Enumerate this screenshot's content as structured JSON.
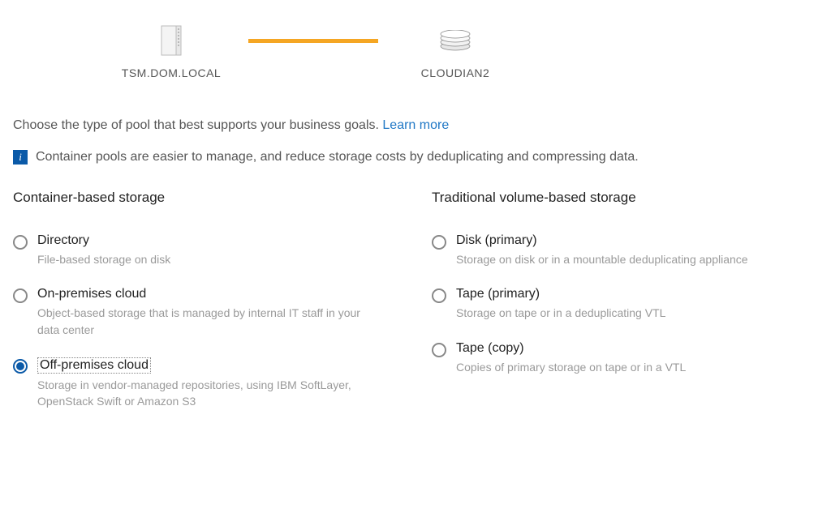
{
  "topology": {
    "source_label": "TSM.DOM.LOCAL",
    "target_label": "CLOUDIAN2"
  },
  "intro": {
    "text": "Choose the type of pool that best supports your business goals. ",
    "learn_more": "Learn more"
  },
  "info": {
    "text": "Container pools are easier to manage, and reduce storage costs by deduplicating and compressing data."
  },
  "columns": {
    "container": {
      "header": "Container-based storage",
      "options": [
        {
          "title": "Directory",
          "desc": "File-based storage on disk",
          "selected": false,
          "focused": false
        },
        {
          "title": "On-premises cloud",
          "desc": "Object-based storage that is managed by internal IT staff in your data center",
          "selected": false,
          "focused": false
        },
        {
          "title": "Off-premises cloud",
          "desc": "Storage in vendor-managed repositories, using IBM SoftLayer, OpenStack Swift or Amazon S3",
          "selected": true,
          "focused": true
        }
      ]
    },
    "traditional": {
      "header": "Traditional volume-based storage",
      "options": [
        {
          "title": "Disk (primary)",
          "desc": "Storage on disk or in a mountable deduplicating appliance",
          "selected": false,
          "focused": false
        },
        {
          "title": "Tape (primary)",
          "desc": "Storage on tape or in a deduplicating VTL",
          "selected": false,
          "focused": false
        },
        {
          "title": "Tape (copy)",
          "desc": "Copies of primary storage on tape or in a VTL",
          "selected": false,
          "focused": false
        }
      ]
    }
  }
}
